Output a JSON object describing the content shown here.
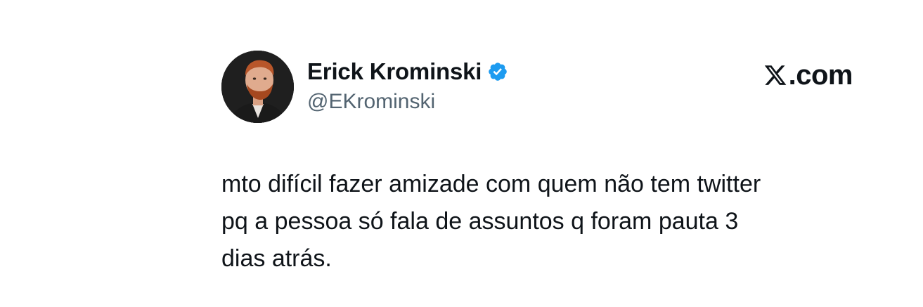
{
  "author": {
    "display_name": "Erick Krominski",
    "handle": "@EKrominski",
    "verified": true,
    "avatar_icon": "profile-photo",
    "verified_color": "#1d9bf0"
  },
  "brand": {
    "icon": "x-logo-icon",
    "text": ".com"
  },
  "tweet": {
    "text": "mto difícil fazer amizade com quem não tem twitter\npq a pessoa só fala de assuntos q foram pauta 3\ndias atrás."
  },
  "colors": {
    "text_primary": "#0f1419",
    "text_secondary": "#536471",
    "background": "#ffffff"
  }
}
